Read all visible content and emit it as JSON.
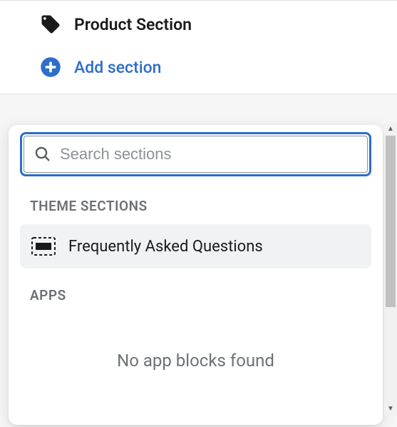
{
  "top": {
    "section_title": "Product Section",
    "add_label": "Add section"
  },
  "search": {
    "placeholder": "Search sections",
    "value": ""
  },
  "groups": {
    "theme": {
      "header": "THEME SECTIONS",
      "items": [
        {
          "label": "Frequently Asked Questions"
        }
      ]
    },
    "apps": {
      "header": "APPS",
      "empty_message": "No app blocks found"
    }
  },
  "colors": {
    "accent": "#2c6ecb",
    "text_muted": "#6d7175",
    "hover_bg": "#f1f2f3"
  }
}
